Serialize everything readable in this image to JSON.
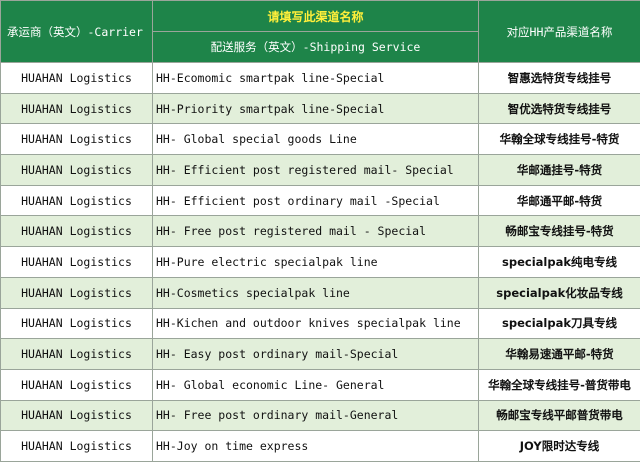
{
  "header": {
    "carrier_col": "承运商（英文）-Carrier",
    "group_title": "请填写此渠道名称",
    "service_col": "配送服务（英文）-Shipping Service",
    "channel_col": "对应HH产品渠道名称"
  },
  "colors": {
    "header_bg": "#1e8449",
    "header_text": "#ffffff",
    "group_title_text": "#ffef3a",
    "stripe": "#e2efda"
  },
  "rows": [
    {
      "carrier": "HUAHAN Logistics",
      "service": "HH-Ecomomic smartpak line-Special",
      "channel": "智惠选特货专线挂号"
    },
    {
      "carrier": "HUAHAN Logistics",
      "service": "HH-Priority smartpak line-Special",
      "channel": "智优选特货专线挂号"
    },
    {
      "carrier": "HUAHAN Logistics",
      "service": "HH- Global special goods Line",
      "channel": "华翰全球专线挂号-特货"
    },
    {
      "carrier": "HUAHAN Logistics",
      "service": "HH- Efficient post registered mail- Special",
      "channel": "华邮通挂号-特货"
    },
    {
      "carrier": "HUAHAN Logistics",
      "service": "HH- Efficient post ordinary mail -Special",
      "channel": "华邮通平邮-特货"
    },
    {
      "carrier": "HUAHAN Logistics",
      "service": "HH- Free post registered mail - Special",
      "channel": "畅邮宝专线挂号-特货"
    },
    {
      "carrier": "HUAHAN Logistics",
      "service": "HH-Pure electric specialpak line",
      "channel": "specialpak纯电专线"
    },
    {
      "carrier": "HUAHAN Logistics",
      "service": "HH-Cosmetics specialpak line",
      "channel": "specialpak化妆品专线"
    },
    {
      "carrier": "HUAHAN Logistics",
      "service": "HH-Kichen and outdoor knives specialpak line",
      "channel": "specialpak刀具专线"
    },
    {
      "carrier": "HUAHAN Logistics",
      "service": "HH- Easy post ordinary mail-Special",
      "channel": "华翰易速通平邮-特货"
    },
    {
      "carrier": "HUAHAN Logistics",
      "service": "HH- Global economic Line- General",
      "channel": "华翰全球专线挂号-普货带电"
    },
    {
      "carrier": "HUAHAN Logistics",
      "service": "HH- Free post ordinary mail-General",
      "channel": "畅邮宝专线平邮普货带电"
    },
    {
      "carrier": "HUAHAN Logistics",
      "service": "HH-Joy on time express",
      "channel": "JOY限时达专线"
    }
  ]
}
